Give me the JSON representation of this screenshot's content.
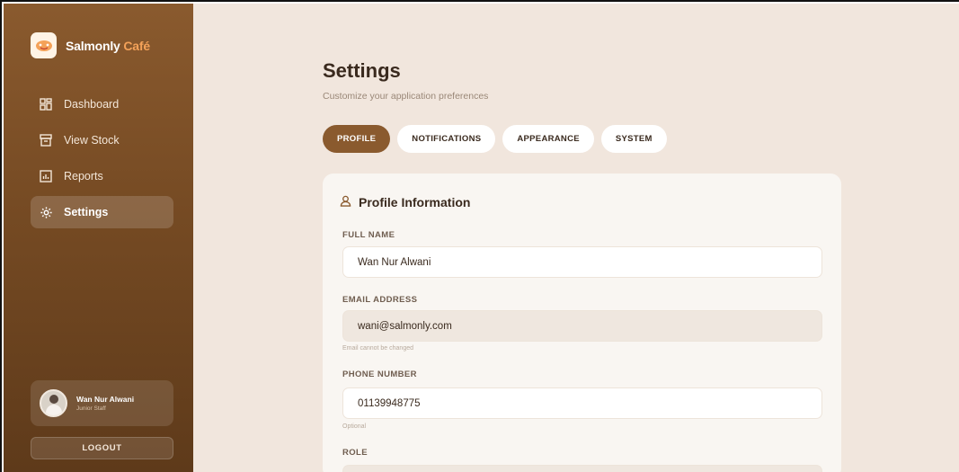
{
  "brand": {
    "name": "Salmonly",
    "accent": "Café",
    "accent_color": "#f4a259",
    "logo_icon": "cafe-logo-icon"
  },
  "nav": [
    {
      "label": "Dashboard",
      "icon": "grid-icon",
      "active": false
    },
    {
      "label": "View Stock",
      "icon": "box-icon",
      "active": false
    },
    {
      "label": "Reports",
      "icon": "chart-icon",
      "active": false
    },
    {
      "label": "Settings",
      "icon": "gear-icon",
      "active": true
    }
  ],
  "user": {
    "name": "Wan Nur Alwani",
    "role": "Junior Staff"
  },
  "logout_label": "LOGOUT",
  "page": {
    "title": "Settings",
    "subtitle": "Customize your application preferences"
  },
  "tabs": [
    {
      "label": "PROFILE",
      "active": true
    },
    {
      "label": "NOTIFICATIONS",
      "active": false
    },
    {
      "label": "APPEARANCE",
      "active": false
    },
    {
      "label": "SYSTEM",
      "active": false
    }
  ],
  "profile": {
    "title": "Profile Information",
    "full_name_label": "FULL NAME",
    "full_name": "Wan Nur Alwani",
    "email_label": "EMAIL ADDRESS",
    "email": "wani@salmonly.com",
    "email_hint": "Email cannot be changed",
    "phone_label": "PHONE NUMBER",
    "phone": "01139948775",
    "phone_hint": "Optional",
    "role_label": "ROLE"
  },
  "colors": {
    "primary": "#8a5a2e",
    "background": "#f1e6dd",
    "card": "#f9f6f2"
  }
}
